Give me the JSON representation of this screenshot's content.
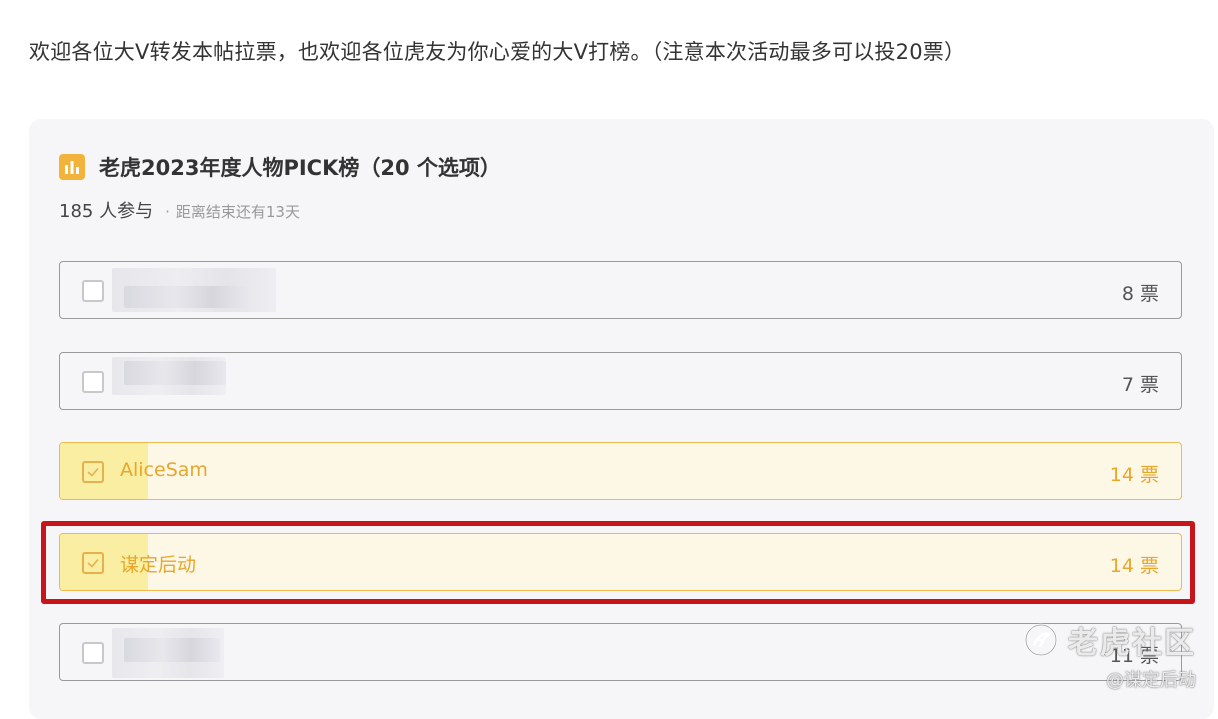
{
  "intro_text": "欢迎各位大V转发本帖拉票，也欢迎各位虎友为你心爱的大V打榜。（注意本次活动最多可以投20票）",
  "poll": {
    "title": "老虎2023年度人物PICK榜（20 个选项）",
    "participants": "185 人参与",
    "separator": "·",
    "deadline": "距离结束还有13天",
    "icon": "bar-chart-icon",
    "accent_color": "#f0b94e",
    "options": [
      {
        "label": "",
        "votes": "8 票",
        "selected": false,
        "blurred": true
      },
      {
        "label": "",
        "votes": "7 票",
        "selected": false,
        "blurred": true
      },
      {
        "label": "AliceSam",
        "votes": "14 票",
        "selected": true,
        "blurred": false
      },
      {
        "label": "谋定后动",
        "votes": "14 票",
        "selected": true,
        "blurred": false
      },
      {
        "label": "",
        "votes": "11 票",
        "selected": false,
        "blurred": true
      }
    ]
  },
  "highlight_color": "#c8141b",
  "watermark": {
    "name": "老虎社区",
    "user": "@谋定后动"
  }
}
